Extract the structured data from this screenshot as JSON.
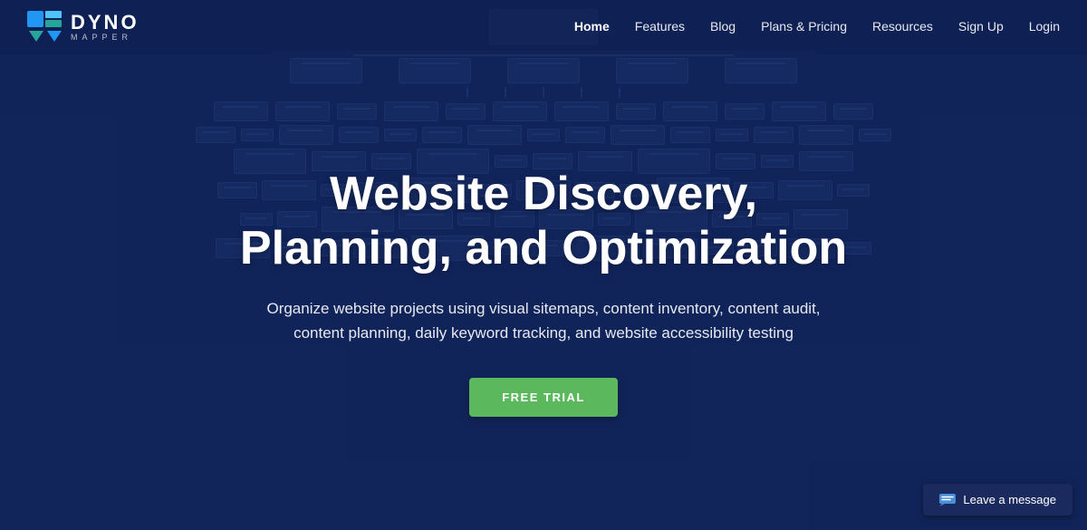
{
  "navbar": {
    "logo_brand": "DYNO",
    "logo_sub": "MAPPER",
    "nav_links": [
      {
        "label": "Home",
        "active": true
      },
      {
        "label": "Features",
        "active": false
      },
      {
        "label": "Blog",
        "active": false
      },
      {
        "label": "Plans & Pricing",
        "active": false
      },
      {
        "label": "Resources",
        "active": false
      },
      {
        "label": "Sign Up",
        "active": false
      },
      {
        "label": "Login",
        "active": false
      }
    ]
  },
  "hero": {
    "title": "Website Discovery, Planning, and Optimization",
    "subtitle": "Organize website projects using visual sitemaps, content inventory, content audit, content planning, daily keyword tracking, and website accessibility testing",
    "cta_label": "FREE TRIAL"
  },
  "chat": {
    "label": "Leave a message"
  },
  "colors": {
    "background": "#1a2a5e",
    "cta_bg": "#5cb85c",
    "nav_active": "#ffffff"
  }
}
